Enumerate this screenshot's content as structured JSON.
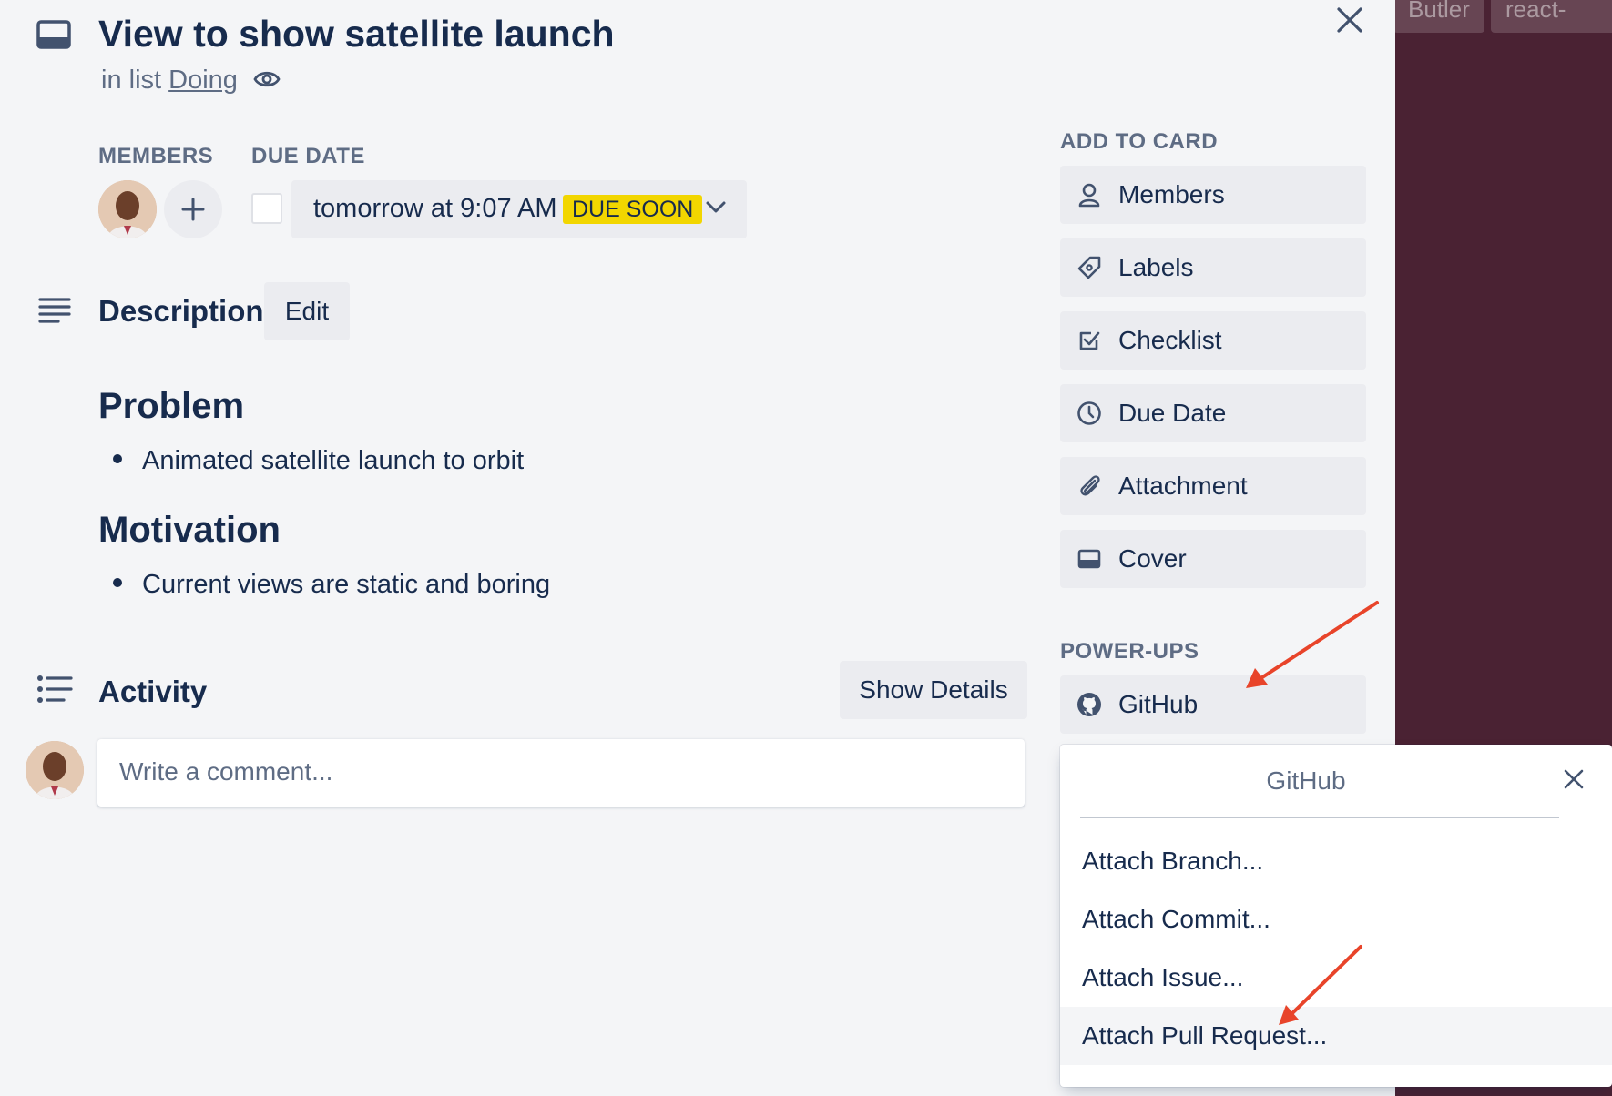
{
  "board": {
    "buttons": [
      "Butler",
      "react-"
    ]
  },
  "card": {
    "title": "View to show satellite launch",
    "list_prefix": "in list ",
    "list_name": "Doing"
  },
  "members": {
    "label": "MEMBERS"
  },
  "due": {
    "label": "DUE DATE",
    "value": "tomorrow at 9:07 AM",
    "badge": "DUE SOON",
    "badge_color": "#f2d600"
  },
  "description": {
    "heading": "Description",
    "edit_label": "Edit",
    "blocks": [
      {
        "heading": "Problem",
        "items": [
          "Animated satellite launch to orbit"
        ]
      },
      {
        "heading": "Motivation",
        "items": [
          "Current views are static and boring"
        ]
      }
    ]
  },
  "activity": {
    "heading": "Activity",
    "show_details_label": "Show Details",
    "comment_placeholder": "Write a comment..."
  },
  "sidebar": {
    "add_to_card_label": "ADD TO CARD",
    "items": [
      {
        "label": "Members",
        "icon": "person-icon"
      },
      {
        "label": "Labels",
        "icon": "tag-icon"
      },
      {
        "label": "Checklist",
        "icon": "checkbox-icon"
      },
      {
        "label": "Due Date",
        "icon": "clock-icon"
      },
      {
        "label": "Attachment",
        "icon": "paperclip-icon"
      },
      {
        "label": "Cover",
        "icon": "cover-icon"
      }
    ],
    "powerups_label": "POWER-UPS",
    "powerups": [
      {
        "label": "GitHub",
        "icon": "github-icon"
      }
    ]
  },
  "github_popover": {
    "title": "GitHub",
    "items": [
      "Attach Branch...",
      "Attach Commit...",
      "Attach Issue...",
      "Attach Pull Request..."
    ]
  },
  "colors": {
    "annotation_arrow": "#e8442a",
    "board_background": "#4a2233"
  }
}
